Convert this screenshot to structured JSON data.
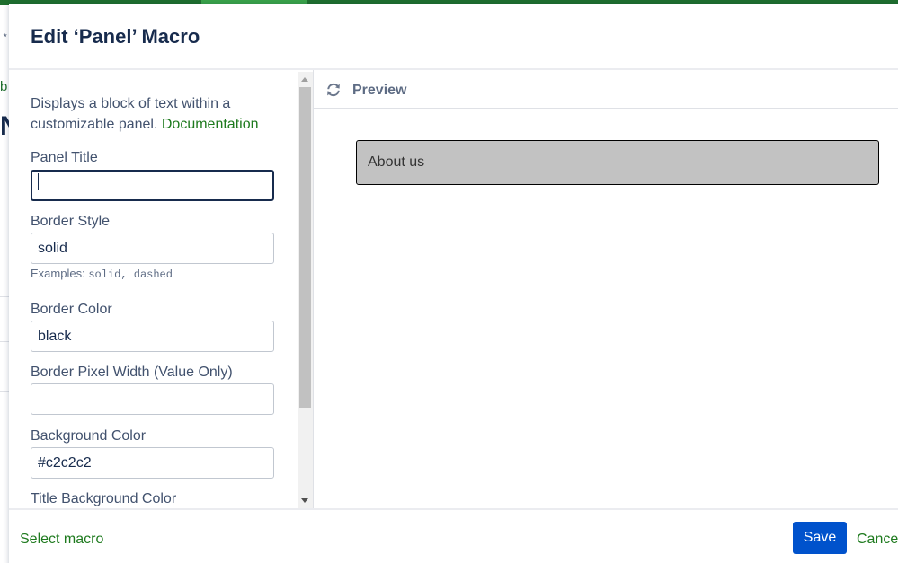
{
  "dialog": {
    "title": "Edit ‘Panel’ Macro"
  },
  "form": {
    "description": "Displays a block of text within a customizable panel.",
    "documentation_link": "Documentation",
    "fields": {
      "panel_title": {
        "label": "Panel Title",
        "value": ""
      },
      "border_style": {
        "label": "Border Style",
        "value": "solid",
        "hint_prefix": "Examples:",
        "hint_examples": "solid, dashed"
      },
      "border_color": {
        "label": "Border Color",
        "value": "black"
      },
      "border_pixel_width": {
        "label": "Border Pixel Width (Value Only)",
        "value": ""
      },
      "background_color": {
        "label": "Background Color",
        "value": "#c2c2c2"
      },
      "title_background_color": {
        "label": "Title Background Color",
        "value": ""
      }
    }
  },
  "preview": {
    "label": "Preview",
    "panel_text": "About us",
    "panel_background": "#c2c2c2",
    "panel_border_color": "#000000"
  },
  "footer": {
    "select_macro": "Select macro",
    "save": "Save",
    "cancel": "Cancel"
  },
  "colors": {
    "accent_blue": "#0052cc",
    "link_green": "#1e7a1e"
  },
  "icons": {
    "refresh": "refresh-icon"
  }
}
